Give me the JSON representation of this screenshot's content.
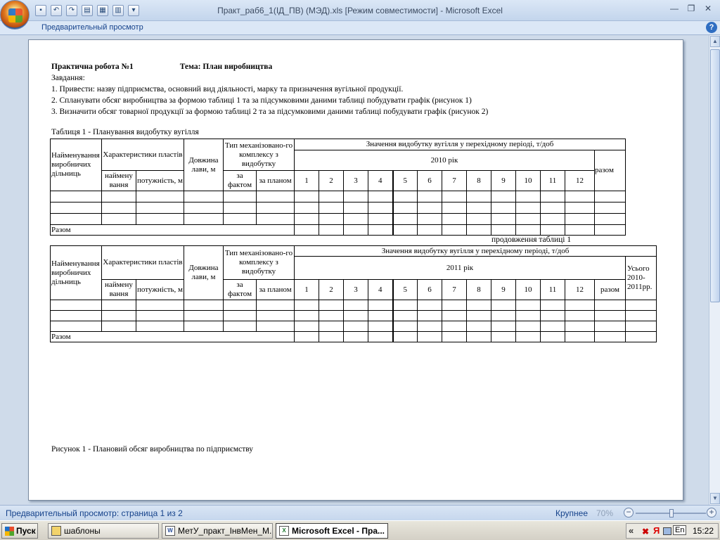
{
  "window": {
    "title": "Практ_раб6_1(ІД_ПВ) (МЭД).xls  [Режим совместимости]  -  Microsoft Excel"
  },
  "ribbon": {
    "mode_label": "Предварительный просмотр"
  },
  "doc": {
    "heading_left": "Практична робота №1",
    "heading_right": "Тема: План виробництва",
    "task_label": "Завдання:",
    "tasks": [
      "1. Привести: назву підприємства, основний вид діяльності, марку та призначення вугільної продукції.",
      "2. Спланувати обсяг виробництва за формою таблиці 1 та за підсумковими даними таблиці  побудувати графік (рисунок 1)",
      "3. Визначити обсяг товарної продукції за формою таблиці 2 та за підсумковими даними таблиці  побудувати графік (рисунок 2)"
    ],
    "table1_caption": "Таблиця 1 -     Планування видобутку вугілля",
    "table2_caption": "продовження таблиці 1",
    "figure_caption": "Рисунок 1 - Плановий обсяг виробництва по підприємству"
  },
  "table": {
    "col_site": "Найменування виробничих дільниць",
    "col_char": "Характеристики пластів",
    "col_char_name": "наймену вання",
    "col_char_power": "потужність, м",
    "col_length": "Довжина лави, м",
    "col_type": "Тип механізовано-го комплексу з видобутку",
    "col_fact": "за фактом",
    "col_plan": "за планом",
    "col_values": "Значення видобутку вугілля у перехідному періоді, т/доб",
    "year1": "2010 рік",
    "year2": "2011 рік",
    "months": [
      "1",
      "2",
      "3",
      "4",
      "5",
      "6",
      "7",
      "8",
      "9",
      "10",
      "11",
      "12"
    ],
    "col_total": "разом",
    "col_grand_total": "Усього 2010-2011рр.",
    "row_total": "Разом"
  },
  "status": {
    "text": "Предварительный просмотр: страница 1 из 2",
    "zoom_label": "Крупнее",
    "zoom_value": "70%"
  },
  "taskbar": {
    "start": "Пуск",
    "items": [
      "шаблоны",
      "МетУ_практ_ІнвМен_М...",
      "Microsoft Excel - Пра..."
    ],
    "lang": "En",
    "clock": "15:22"
  }
}
